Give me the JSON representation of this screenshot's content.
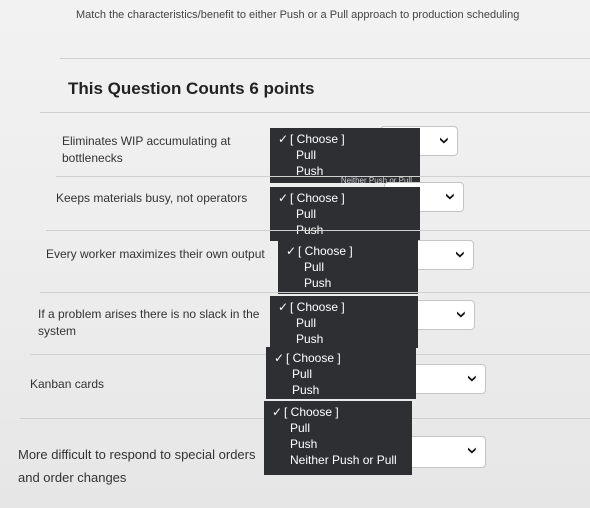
{
  "prompt": "Match the characteristics/benefit to either Push or a Pull approach to production scheduling",
  "points_heading": "This Question Counts 6 points",
  "rows": [
    {
      "label": "Eliminates WIP accumulating at bottlenecks",
      "options": [
        "[ Choose ]",
        "Pull",
        "Push"
      ]
    },
    {
      "label": "Keeps materials busy, not operators",
      "options": [
        "[ Choose ]",
        "Pull",
        "Push"
      ]
    },
    {
      "label": "Every worker maximizes their own output",
      "options": [
        "[ Choose ]",
        "Pull",
        "Push"
      ]
    },
    {
      "label": "If a problem arises there is no slack in the system",
      "options": [
        "[ Choose ]",
        "Pull",
        "Push"
      ]
    },
    {
      "label": "Kanban cards",
      "options": [
        "[ Choose ]",
        "Pull",
        "Push"
      ]
    },
    {
      "label": "More difficult to respond to special orders and order changes",
      "options": [
        "[ Choose ]",
        "Pull",
        "Push",
        "Neither Push or Pull"
      ]
    }
  ],
  "hidden_option_peek": "Neither Push or Pull",
  "icons": {
    "checkmark": "checkmark-icon",
    "chevron": "chevron-down-icon"
  }
}
